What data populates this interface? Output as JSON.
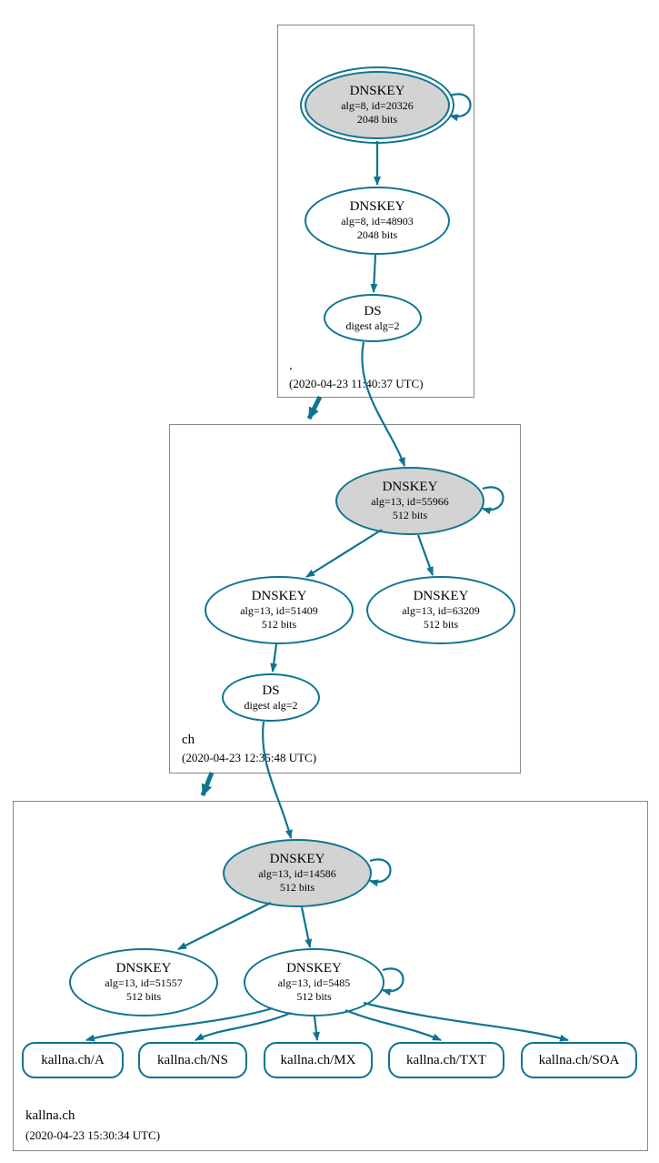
{
  "colors": {
    "teal": "#0E7490",
    "gray": "#d3d3d3"
  },
  "zones": {
    "root": {
      "name": ".",
      "ts": "(2020-04-23 11:40:37 UTC)"
    },
    "ch": {
      "name": "ch",
      "ts": "(2020-04-23 12:35:48 UTC)"
    },
    "leaf": {
      "name": "kallna.ch",
      "ts": "(2020-04-23 15:30:34 UTC)"
    }
  },
  "nodes": {
    "root_ksk": {
      "title": "DNSKEY",
      "sub": "alg=8, id=20326",
      "bits": "2048 bits"
    },
    "root_zsk": {
      "title": "DNSKEY",
      "sub": "alg=8, id=48903",
      "bits": "2048 bits"
    },
    "root_ds": {
      "title": "DS",
      "sub": "digest alg=2"
    },
    "ch_ksk": {
      "title": "DNSKEY",
      "sub": "alg=13, id=55966",
      "bits": "512 bits"
    },
    "ch_zsk1": {
      "title": "DNSKEY",
      "sub": "alg=13, id=51409",
      "bits": "512 bits"
    },
    "ch_zsk2": {
      "title": "DNSKEY",
      "sub": "alg=13, id=63209",
      "bits": "512 bits"
    },
    "ch_ds": {
      "title": "DS",
      "sub": "digest alg=2"
    },
    "leaf_ksk": {
      "title": "DNSKEY",
      "sub": "alg=13, id=14586",
      "bits": "512 bits"
    },
    "leaf_zsk1": {
      "title": "DNSKEY",
      "sub": "alg=13, id=51557",
      "bits": "512 bits"
    },
    "leaf_zsk2": {
      "title": "DNSKEY",
      "sub": "alg=13, id=5485",
      "bits": "512 bits"
    }
  },
  "rr": {
    "a": "kallna.ch/A",
    "ns": "kallna.ch/NS",
    "mx": "kallna.ch/MX",
    "txt": "kallna.ch/TXT",
    "soa": "kallna.ch/SOA"
  }
}
